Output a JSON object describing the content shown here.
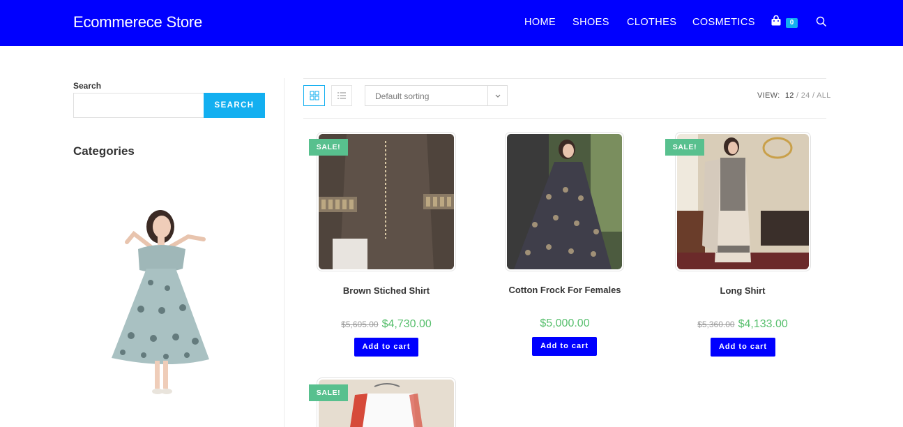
{
  "header": {
    "brand": "Ecommerece Store",
    "nav": [
      "HOME",
      "SHOES",
      "CLOTHES",
      "COSMETICS"
    ],
    "cart_count": "0",
    "cart_icon": "shopping-bag-icon",
    "search_icon": "search-icon",
    "background": "#0000ff"
  },
  "sidebar": {
    "search_label": "Search",
    "search_value": "",
    "search_button": "SEARCH",
    "categories_title": "Categories"
  },
  "toolbar": {
    "grid_icon": "grid-view-icon",
    "list_icon": "list-view-icon",
    "sorting": "Default sorting",
    "view_label": "VIEW:",
    "view_12": "12",
    "view_24": "24",
    "view_all": "ALL",
    "sep": "/"
  },
  "products": [
    {
      "title": "Brown Stiched Shirt",
      "sale_badge": "SALE!",
      "old_price": "$5,605.00",
      "price": "$4,730.00",
      "button": "Add to cart"
    },
    {
      "title": "Cotton Frock For Females",
      "sale_badge": "",
      "old_price": "",
      "price": "$5,000.00",
      "button": "Add to cart"
    },
    {
      "title": "Long Shirt",
      "sale_badge": "SALE!",
      "old_price": "$5,360.00",
      "price": "$4,133.00",
      "button": "Add to cart"
    },
    {
      "title": "",
      "sale_badge": "SALE!",
      "old_price": "",
      "price": "",
      "button": ""
    }
  ],
  "colors": {
    "accent": "#13aff0",
    "sale": "#58c08e",
    "price": "#57bf6d",
    "button": "#0000ff"
  }
}
